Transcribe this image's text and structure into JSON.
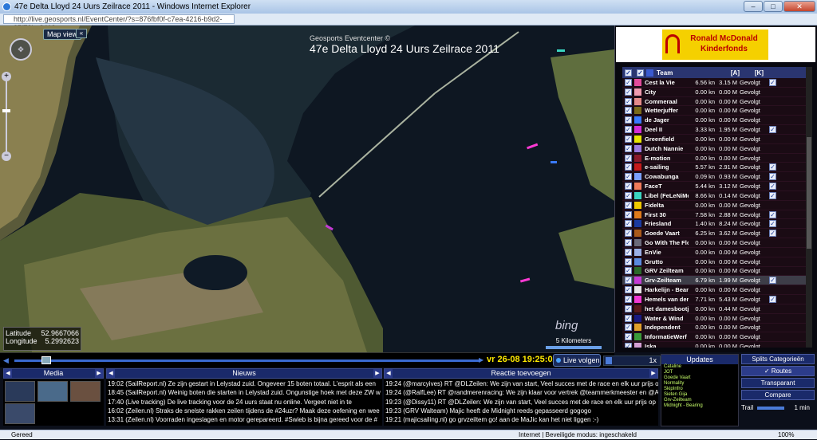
{
  "window": {
    "title": "47e Delta Lloyd 24 Uurs Zeilrace 2011 - Windows Internet Explorer",
    "min": "–",
    "max": "□",
    "close": "✕"
  },
  "address": {
    "url": "http://live.geosports.nl/EventCenter/?s=876fbf0f-c7ea-4216-b9d2-37f73be8413e"
  },
  "map": {
    "view_button": "Map view",
    "collapse_button": "«",
    "header_small": "Geosports Eventcenter ©",
    "header_title": "47e Delta Lloyd 24 Uurs Zeilrace 2011",
    "latitude_label": "Latitude",
    "latitude_value": "52.9667066",
    "longitude_label": "Longitude",
    "longitude_value": "5.2992623",
    "bing_logo": "bing",
    "scale_label": "5 Kilometers"
  },
  "sponsor": {
    "line1": "Ronald McDonald",
    "line2": "Kinderfonds"
  },
  "teamlist": {
    "headers": {
      "team": "Team",
      "speed": "[A]",
      "dist": "[K]"
    },
    "teams": [
      {
        "name": "Cest la Vie",
        "speed": "6.56 kn",
        "dist": "3.15 M",
        "status": "Gevolgt",
        "color": "#e14b9b",
        "follow": true,
        "sel": false
      },
      {
        "name": "City",
        "speed": "0.00 kn",
        "dist": "0.00 M",
        "status": "Gevolgt",
        "color": "#f09ab0",
        "follow": false,
        "sel": false
      },
      {
        "name": "Commeraal",
        "speed": "0.00 kn",
        "dist": "0.00 M",
        "status": "Gevolgt",
        "color": "#e58a8a",
        "follow": false,
        "sel": false
      },
      {
        "name": "Wetterjuffer",
        "speed": "0.00 kn",
        "dist": "0.00 M",
        "status": "Gevolgt",
        "color": "#7a6a1a",
        "follow": false,
        "sel": false
      },
      {
        "name": "de Jager",
        "speed": "0.00 kn",
        "dist": "0.00 M",
        "status": "Gevolgt",
        "color": "#3a7aff",
        "follow": false,
        "sel": false
      },
      {
        "name": "Deel II",
        "speed": "3.33 kn",
        "dist": "1.95 M",
        "status": "Gevolgt",
        "color": "#d42cd4",
        "follow": true,
        "sel": false
      },
      {
        "name": "Greenfield",
        "speed": "0.00 kn",
        "dist": "0.00 M",
        "status": "Gevolgt",
        "color": "#e6e600",
        "follow": false,
        "sel": false
      },
      {
        "name": "Dutch Nannie",
        "speed": "0.00 kn",
        "dist": "0.00 M",
        "status": "Gevolgt",
        "color": "#9a7ae0",
        "follow": false,
        "sel": false
      },
      {
        "name": "E-motion",
        "speed": "0.00 kn",
        "dist": "0.00 M",
        "status": "Gevolgt",
        "color": "#8a1a2a",
        "follow": false,
        "sel": false
      },
      {
        "name": "e-sailing",
        "speed": "5.57 kn",
        "dist": "2.91 M",
        "status": "Gevolgt",
        "color": "#c41a1a",
        "follow": true,
        "sel": false
      },
      {
        "name": "Cowabunga",
        "speed": "0.09 kn",
        "dist": "0.93 M",
        "status": "Gevolgt",
        "color": "#7aa0ff",
        "follow": true,
        "sel": false
      },
      {
        "name": "FaceT",
        "speed": "5.44 kn",
        "dist": "3.12 M",
        "status": "Gevolgt",
        "color": "#f07a5a",
        "follow": true,
        "sel": false
      },
      {
        "name": "Libel (FeLeNiMe)",
        "speed": "8.66 kn",
        "dist": "0.14 M",
        "status": "Gevolgt",
        "color": "#3ad4c0",
        "follow": true,
        "sel": false
      },
      {
        "name": "Fidelta",
        "speed": "0.00 kn",
        "dist": "0.00 M",
        "status": "Gevolgt",
        "color": "#f0c800",
        "follow": false,
        "sel": false
      },
      {
        "name": "First 30",
        "speed": "7.58 kn",
        "dist": "2.88 M",
        "status": "Gevolgt",
        "color": "#e07a1a",
        "follow": true,
        "sel": false
      },
      {
        "name": "Friesland",
        "speed": "1.40 kn",
        "dist": "8.24 M",
        "status": "Gevolgt",
        "color": "#1a3aa0",
        "follow": true,
        "sel": false
      },
      {
        "name": "Goede Vaart",
        "speed": "6.25 kn",
        "dist": "3.62 M",
        "status": "Gevolgt",
        "color": "#aa5a1a",
        "follow": true,
        "sel": false
      },
      {
        "name": "Go With The Flow",
        "speed": "0.00 kn",
        "dist": "0.00 M",
        "status": "Gevolgt",
        "color": "#6a6a7a",
        "follow": false,
        "sel": false
      },
      {
        "name": "EnVie",
        "speed": "0.00 kn",
        "dist": "0.00 M",
        "status": "Gevolgt",
        "color": "#9ab0e8",
        "follow": false,
        "sel": false
      },
      {
        "name": "Grutto",
        "speed": "0.00 kn",
        "dist": "0.00 M",
        "status": "Gevolgt",
        "color": "#5a8ae0",
        "follow": false,
        "sel": false
      },
      {
        "name": "GRV Zeilteam",
        "speed": "0.00 kn",
        "dist": "0.00 M",
        "status": "Gevolgt",
        "color": "#2a6a2a",
        "follow": false,
        "sel": false
      },
      {
        "name": "Grv-Zeilteam",
        "speed": "6.79 kn",
        "dist": "1.99 M",
        "status": "Gevolgt",
        "color": "#c43ad4",
        "follow": true,
        "sel": true
      },
      {
        "name": "Harkelijn - Bearing",
        "speed": "0.00 kn",
        "dist": "0.00 M",
        "status": "Gevolgt",
        "color": "#e6e6e6",
        "follow": false,
        "sel": false
      },
      {
        "name": "Hemels van der Haar",
        "speed": "7.71 kn",
        "dist": "5.43 M",
        "status": "Gevolgt",
        "color": "#f03ad4",
        "follow": true,
        "sel": false
      },
      {
        "name": "het damesbootje",
        "speed": "0.00 kn",
        "dist": "0.44 M",
        "status": "Gevolgt",
        "color": "#5a1a1a",
        "follow": false,
        "sel": false
      },
      {
        "name": "Water & Wind",
        "speed": "0.00 kn",
        "dist": "0.00 M",
        "status": "Gevolgt",
        "color": "#1a1a80",
        "follow": false,
        "sel": false
      },
      {
        "name": "Independent",
        "speed": "0.00 kn",
        "dist": "0.00 M",
        "status": "Gevolgt",
        "color": "#e0a02a",
        "follow": false,
        "sel": false
      },
      {
        "name": "InformatieWerf",
        "speed": "0.00 kn",
        "dist": "0.00 M",
        "status": "Gevolgt",
        "color": "#3a9a3a",
        "follow": false,
        "sel": false
      },
      {
        "name": "Iska",
        "speed": "0.00 kn",
        "dist": "0.00 M",
        "status": "Gevolgt",
        "color": "#d4a0d4",
        "follow": false,
        "sel": false
      }
    ]
  },
  "timeline": {
    "datetime": "vr 26-08 19:25:02",
    "live_label": "Live volgen",
    "speed_label": "1x"
  },
  "panels": {
    "media": "Media",
    "news": "Nieuws",
    "react": "Reactie toevoegen",
    "updates": "Updates"
  },
  "news": [
    "19:02 (SailReport.nl) Ze zijn gestart in Lelystad zuid. Ongeveer 15 boten totaal. L'esprit als een",
    "18:45 (SailReport.nl) Weinig boten die starten in Lelystad zuid. Ongunstige hoek met deze ZW w",
    "17:40 (Live tracking) De live tracking voor de 24 uurs staat nu online. Vergeet niet in te",
    "16:02 (Zeilen.nl) Straks de snelste rakken zeilen tijdens de #24uzr? Maak deze oefening en wee",
    "13:31 (Zeilen.nl) Voorraden ingeslagen en motor gerepareerd. #Swieb is bijna gereed voor de #"
  ],
  "reactions": [
    "19:24 (@marcyives) RT @DLZeilen: We zijn van start, Veel succes met de race en elk uur prijs o",
    "19:24 (@RalfLee) RT @randmerenracing: We zijn klaar voor vertrek @teammerkmeester en @A",
    "19:23 (@Dissy11) RT @DLZeilen: We zijn van start, Veel succes met de race en elk uur prijs op",
    "19:23 (GRV Walteam) Majic heeft de Midnight reeds gepasseerd gogogo",
    "19:21 (majicsailing.nl) go grvzeiltem go! aan de MaJic kan het niet liggen :-)"
  ],
  "updates": [
    "Cataline",
    "JOT",
    "Goede Vaart",
    "Normality",
    "SkipInfro",
    "Sieten Gija",
    "Grv-Zeilteam",
    "Midnight - Bearing"
  ],
  "right_buttons": {
    "splits": "Splits Categorieën",
    "routes": "Routes",
    "transparant": "Transparant",
    "compare": "Compare",
    "trail_label": "Trail",
    "trail_value": "1 min"
  },
  "statusbar": {
    "left": "Gereed",
    "zone": "Internet | Beveiligde modus: ingeschakeld",
    "zoom": "100%"
  }
}
